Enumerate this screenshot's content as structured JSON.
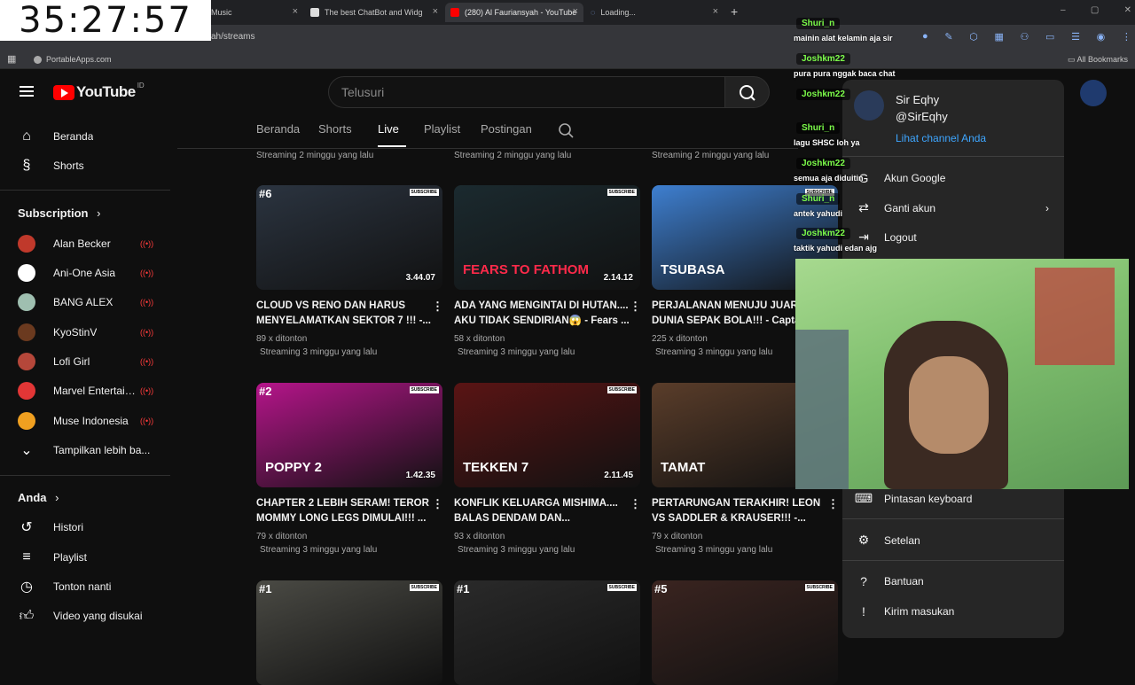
{
  "browser": {
    "tabs": [
      {
        "label": "Music",
        "active": false
      },
      {
        "label": "The best ChatBot and Widg",
        "active": false
      },
      {
        "label": "(280) Al Fauriansyah - YouTube",
        "active": true
      },
      {
        "label": "Loading...",
        "active": false
      }
    ],
    "url": "ah/streams",
    "bookmark": "PortableApps.com",
    "all_bookmarks": "All Bookmarks"
  },
  "timer": "35:27:57",
  "youtube": {
    "logo_text": "YouTube",
    "country": "ID",
    "search_placeholder": "Telusuri"
  },
  "sidebar": {
    "main": [
      {
        "label": "Beranda",
        "icon": "home-icon"
      },
      {
        "label": "Shorts",
        "icon": "shorts-icon"
      }
    ],
    "subscription_header": "Subscription",
    "subscriptions": [
      {
        "label": "Alan Becker",
        "color": "#c0392b"
      },
      {
        "label": "Ani-One Asia",
        "color": "#ffffff"
      },
      {
        "label": "BANG ALEX",
        "color": "#9fbfb0"
      },
      {
        "label": "KyoStinV",
        "color": "#6b3a1f"
      },
      {
        "label": "Lofi Girl",
        "color": "#b5473a"
      },
      {
        "label": "Marvel Entertain...",
        "color": "#e23636"
      },
      {
        "label": "Muse Indonesia",
        "color": "#f0a020"
      }
    ],
    "show_more": "Tampilkan lebih ba...",
    "you_header": "Anda",
    "you_items": [
      {
        "label": "Histori",
        "icon": "history-icon"
      },
      {
        "label": "Playlist",
        "icon": "playlist-icon"
      },
      {
        "label": "Tonton nanti",
        "icon": "watch-later-icon"
      },
      {
        "label": "Video yang disukai",
        "icon": "like-icon"
      }
    ]
  },
  "channel_tabs": [
    "Beranda",
    "Shorts",
    "Live",
    "Playlist",
    "Postingan"
  ],
  "active_tab": "Live",
  "top_meta": [
    "Streaming 2 minggu yang lalu",
    "Streaming 2 minggu yang lalu",
    "Streaming 2 minggu yang lalu"
  ],
  "videos": [
    {
      "rank": "#6",
      "thumb_text": "",
      "duration": "3.44.07",
      "title1": "CLOUD VS RENO DAN HARUS",
      "title2": "MENYELAMATKAN SEKTOR 7 !!! -...",
      "views": "89 x ditonton",
      "when": "Streaming 3 minggu yang lalu",
      "bg": "#2b3440"
    },
    {
      "rank": "",
      "thumb_text": "FEARS TO FATHOM",
      "duration": "2.14.12",
      "title1": "ADA YANG MENGINTAI DI HUTAN....",
      "title2": "AKU TIDAK SENDIRIAN😱 - Fears ...",
      "views": "58 x ditonton",
      "when": "Streaming 3 minggu yang lalu",
      "bg": "#1b2a2f"
    },
    {
      "rank": "",
      "thumb_text": "TSUBASA",
      "duration": "",
      "title1": "PERJALANAN MENUJU JUARA",
      "title2": "DUNIA SEPAK BOLA!!! - Captain",
      "views": "225 x ditonton",
      "when": "Streaming 3 minggu yang lalu",
      "bg": "#3e7fd0"
    },
    {
      "rank": "#2",
      "thumb_text": "POPPY 2",
      "duration": "1.42.35",
      "title1": "CHAPTER 2 LEBIH SERAM! TEROR",
      "title2": "MOMMY LONG LEGS DIMULAI!!! ...",
      "views": "79 x ditonton",
      "when": "Streaming 3 minggu yang lalu",
      "bg": "#b5158a"
    },
    {
      "rank": "",
      "thumb_text": "TEKKEN 7",
      "duration": "2.11.45",
      "title1": "KONFLIK KELUARGA MISHIMA....",
      "title2": "BALAS DENDAM DAN...",
      "views": "93 x ditonton",
      "when": "Streaming 3 minggu yang lalu",
      "bg": "#5a1414"
    },
    {
      "rank": "",
      "thumb_text": "TAMAT",
      "duration": "",
      "title1": "PERTARUNGAN TERAKHIR! LEON",
      "title2": "VS SADDLER & KRAUSER!!! -...",
      "views": "79 x ditonton",
      "when": "Streaming 3 minggu yang lalu",
      "bg": "#5a3d2a"
    },
    {
      "rank": "#1",
      "thumb_text": "",
      "duration": "",
      "title1": "",
      "title2": "",
      "views": "",
      "when": "",
      "bg": "#4a4a44"
    },
    {
      "rank": "#1",
      "thumb_text": "",
      "duration": "",
      "title1": "",
      "title2": "",
      "views": "",
      "when": "",
      "bg": "#2a2a2a"
    },
    {
      "rank": "#5",
      "thumb_text": "",
      "duration": "",
      "title1": "",
      "title2": "",
      "views": "",
      "when": "",
      "bg": "#3a2420"
    }
  ],
  "account_menu": {
    "name": "Sir Eqhy",
    "handle": "@SirEqhy",
    "view_channel": "Lihat channel Anda",
    "items": [
      {
        "label": "Akun Google",
        "icon": "google-icon"
      },
      {
        "label": "Ganti akun",
        "icon": "switch-account-icon"
      },
      {
        "label": "Logout",
        "icon": "logout-icon"
      },
      {
        "label": "Pintasan keyboard",
        "icon": "keyboard-icon"
      },
      {
        "label": "Setelan",
        "icon": "settings-icon"
      },
      {
        "label": "Bantuan",
        "icon": "help-icon"
      },
      {
        "label": "Kirim masukan",
        "icon": "feedback-icon"
      }
    ]
  },
  "chat": [
    {
      "name": "Shuri_n",
      "msg": "mainin alat kelamin aja sir"
    },
    {
      "name": "Joshkm22",
      "msg": "pura pura nggak baca chat"
    },
    {
      "name": "Joshkm22",
      "msg": ""
    },
    {
      "name": "Shuri_n",
      "msg": "lagu SHSC loh ya"
    },
    {
      "name": "Joshkm22",
      "msg": "semua aja diduitin"
    },
    {
      "name": "Shuri_n",
      "msg": "antek yahudi"
    },
    {
      "name": "Joshkm22",
      "msg": "taktik yahudi edan ajg"
    }
  ]
}
